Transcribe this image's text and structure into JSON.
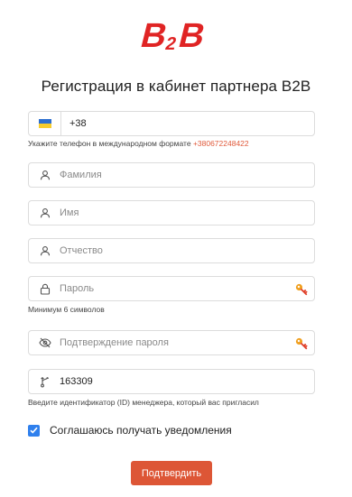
{
  "brand": {
    "logo_text": "B2B",
    "logo_color": "#e02424"
  },
  "page": {
    "title": "Регистрация в кабинет партнера B2B"
  },
  "colors": {
    "accent": "#dd5636",
    "checkbox": "#2f80ed",
    "hint_accent": "#e05a3b"
  },
  "form": {
    "phone": {
      "country_flag": "ukraine-flag",
      "value": "+38",
      "hint": "Укажите телефон в международном формате",
      "hint_example": "+380672248422"
    },
    "last_name": {
      "placeholder": "Фамилия",
      "icon": "user-icon"
    },
    "first_name": {
      "placeholder": "Имя",
      "icon": "user-icon"
    },
    "middle_name": {
      "placeholder": "Отчество",
      "icon": "user-icon"
    },
    "password": {
      "placeholder": "Пароль",
      "icon": "lock-icon",
      "hint": "Минимум 6 символов",
      "key_icon": "key-icon"
    },
    "password_confirm": {
      "placeholder": "Подтверждение пароля",
      "icon": "eye-off-icon",
      "key_icon": "key-icon"
    },
    "manager_id": {
      "value": "163309",
      "icon": "branch-icon",
      "hint": "Введите идентификатор (ID) менеджера, который вас пригласил"
    },
    "notifications": {
      "checked": true,
      "label": "Соглашаюсь получать уведомления"
    },
    "submit_label": "Подтвердить"
  }
}
